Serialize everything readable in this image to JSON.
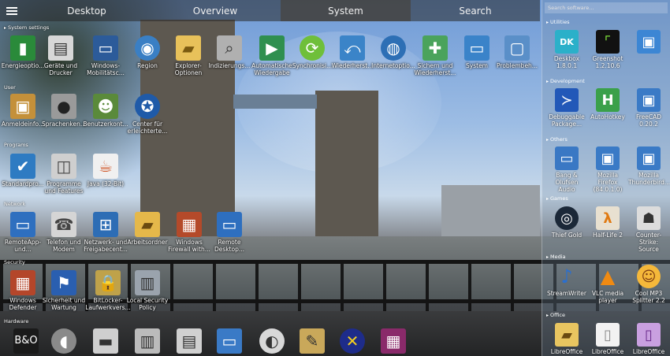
{
  "tabs": [
    "Desktop",
    "Overview",
    "System",
    "Search"
  ],
  "sections": {
    "system_settings": "System settings",
    "user": "User",
    "programs": "Programs",
    "network": "Network",
    "security": "Security",
    "hardware": "Hardware"
  },
  "system_icons": [
    "Energieoptio...",
    "Geräte und Drucker",
    "Windows-Mobilitätsc...",
    "Region",
    "Explorer-Optionen",
    "Indizierungs...",
    "Automatische Wiedergabe",
    "Synchronisi...",
    "Wiederherst...",
    "Internetoptio...",
    "Sichern und Wiederherst...",
    "System",
    "Problembeh..."
  ],
  "user_icons": [
    "Anmeldeinfo...",
    "Sprachenken...",
    "Benutzerkont...",
    "Center für erleichterte..."
  ],
  "program_icons": [
    "Standardpro...",
    "Programme und Features",
    "Java (32-Bit)"
  ],
  "network_icons": [
    "RemoteApp-und...",
    "Telefon und Modem",
    "Netzwerk- und Freigabecent...",
    "Arbeitsordner",
    "Windows Firewall with...",
    "Remote Desktop..."
  ],
  "security_icons": [
    "Windows Defender",
    "Sicherheit und Wartung",
    "BitLocker-Laufwerkvers...",
    "Local Security Policy"
  ],
  "panel": {
    "search_placeholder": "Search software...",
    "sections": {
      "utilities": "Utilities",
      "development": "Development",
      "others": "Others",
      "games": "Games",
      "media": "Media",
      "office": "Office"
    },
    "utilities": [
      "Deskbox 1.8.0.1",
      "Greenshot 1.2.10.6",
      ""
    ],
    "development": [
      "Debuggable Package...",
      "AutoHotkey",
      "FreeCAD 0.20.2"
    ],
    "others": [
      "Bang & Olufsen Audio",
      "Mozilla Firefox (84.0.1.0)",
      "Mozilla Thunderbird..."
    ],
    "games": [
      "Thief Gold",
      "Half-Life 2",
      "Counter-Strike: Source"
    ],
    "media": [
      "StreamWriter",
      "VLC media player",
      "Cool MP3 Splitter 2.2"
    ],
    "office": [
      "LibreOffice",
      "LibreOffice",
      "LibreOffice"
    ]
  }
}
